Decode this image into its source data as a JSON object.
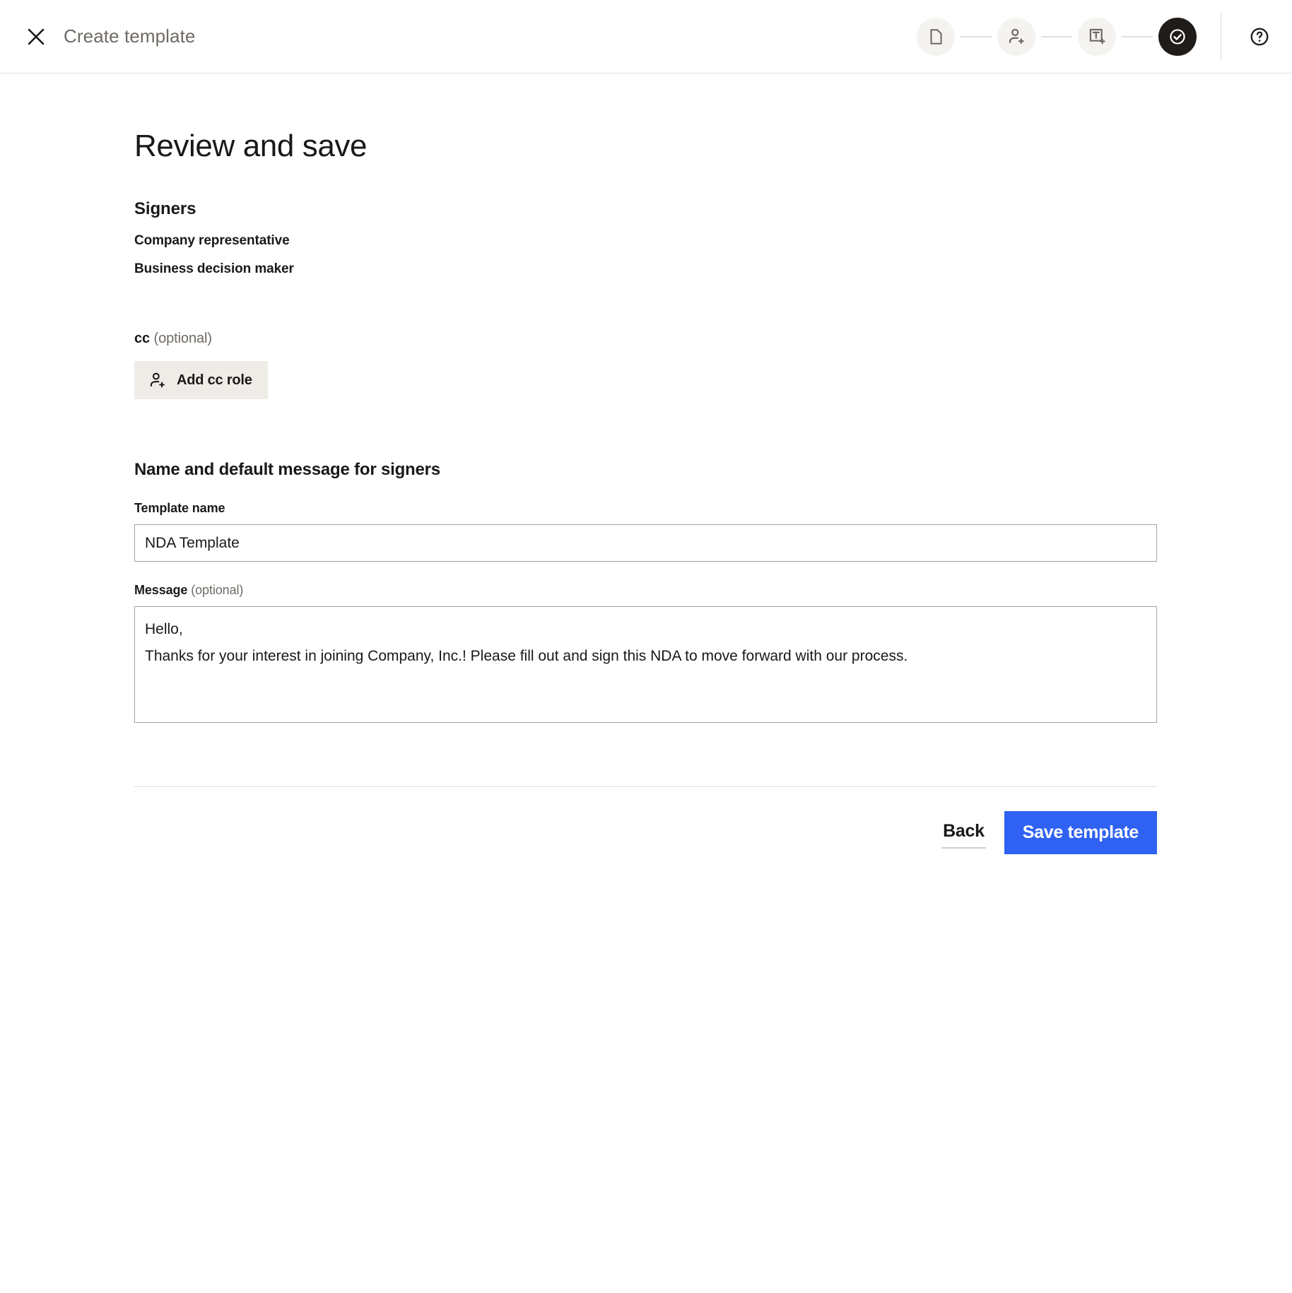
{
  "header": {
    "close_icon": "close-icon",
    "title": "Create template",
    "help_icon": "help-circle-icon",
    "steps": [
      {
        "icon": "document-icon",
        "active": false
      },
      {
        "icon": "add-person-icon",
        "active": false
      },
      {
        "icon": "add-text-field-icon",
        "active": false
      },
      {
        "icon": "check-circle-icon",
        "active": true
      }
    ]
  },
  "main": {
    "page_title": "Review and save",
    "signers": {
      "heading": "Signers",
      "roles": [
        "Company representative",
        "Business decision maker"
      ]
    },
    "cc": {
      "label": "cc",
      "optional": "(optional)",
      "add_button_label": "Add cc role",
      "add_button_icon": "add-person-icon"
    },
    "form": {
      "heading": "Name and default message for signers",
      "template_name_label": "Template name",
      "template_name_value": "NDA Template",
      "template_name_placeholder": "Template name",
      "message_label": "Message",
      "message_optional": "(optional)",
      "message_value": "Hello,\nThanks for your interest in joining Company, Inc.! Please fill out and sign this NDA to move forward with our process.",
      "message_placeholder": "Message"
    },
    "actions": {
      "back_label": "Back",
      "save_label": "Save template"
    }
  },
  "colors": {
    "accent_blue": "#2f62f2",
    "step_active": "#1f1c1a",
    "step_inactive_bg": "#f5f3f0",
    "button_bg": "#efece7",
    "border": "#a8a19a",
    "muted_text": "#6f6a64"
  }
}
